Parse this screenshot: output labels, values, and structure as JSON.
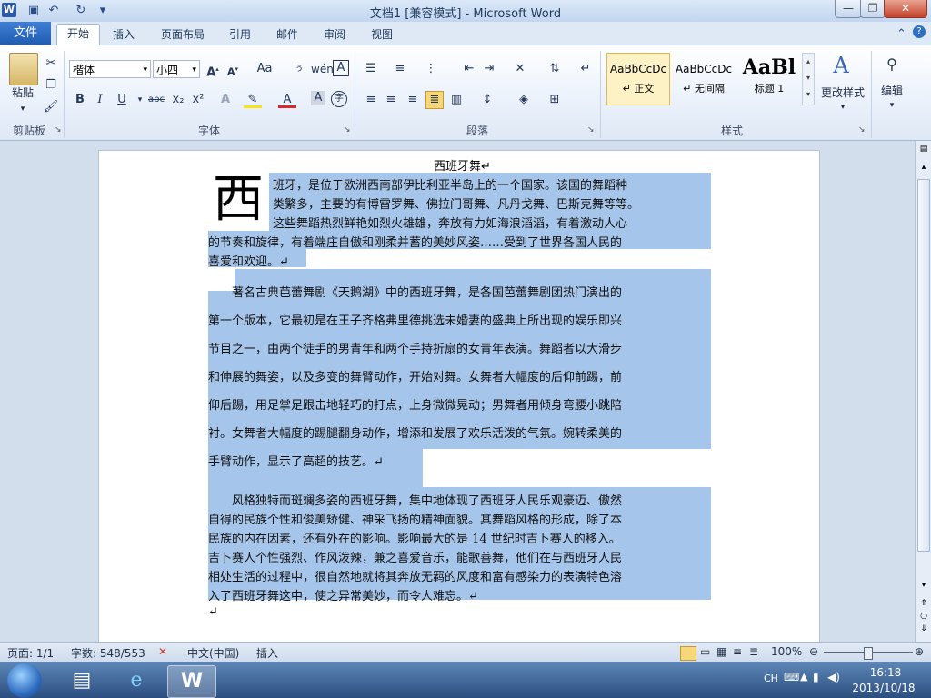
{
  "window": {
    "title": "文档1 [兼容模式]  -  Microsoft Word",
    "app_icon": "W",
    "controls": [
      "—",
      "❐",
      "✕"
    ]
  },
  "quick_access": {
    "save": "💾",
    "undo": "↶",
    "redo": "↻",
    "customize": "▾"
  },
  "tabs": {
    "file": "文件",
    "items": [
      "开始",
      "插入",
      "页面布局",
      "引用",
      "邮件",
      "审阅",
      "视图"
    ],
    "active_index": 0
  },
  "ribbon": {
    "clipboard": {
      "label": "剪贴板",
      "paste": "粘贴"
    },
    "font": {
      "label": "字体",
      "family": "楷体",
      "size": "小四",
      "buttons": [
        "A",
        "A",
        "Aa",
        "wén",
        "變",
        "A"
      ],
      "format_buttons": [
        "B",
        "I",
        "U",
        "abc",
        "x₂",
        "x²"
      ]
    },
    "paragraph": {
      "label": "段落"
    },
    "styles": {
      "label": "样式",
      "cards": [
        {
          "preview": "AaBbCcDc",
          "name": "↵ 正文"
        },
        {
          "preview": "AaBbCcDc",
          "name": "↵ 无间隔"
        },
        {
          "preview": "AaBl",
          "name": "标题 1"
        }
      ],
      "change_styles": "更改样式"
    },
    "editing": {
      "label": "编辑"
    }
  },
  "document": {
    "title": "西班牙舞↵",
    "dropcap": "西",
    "para1_lines": [
      "班牙，是位于欧洲西南部伊比利亚半岛上的一个国家。该国的舞蹈种",
      "类繁多，主要的有博雷罗舞、佛拉门哥舞、凡丹戈舞、巴斯克舞等等。",
      "这些舞蹈热烈鲜艳如烈火雄雄，奔放有力如海浪滔滔，有着激动人心",
      "的节奏和旋律，有着端庄自傲和刚柔并蓄的美妙风姿……受到了世界各国人民的",
      "喜爱和欢迎。↵"
    ],
    "para2_lines": [
      "　　著名古典芭蕾舞剧《天鹅湖》中的西班牙舞，是各国芭蕾舞剧团热门演出的",
      "第一个版本，它最初是在王子齐格弗里德挑选未婚妻的盛典上所出现的娱乐即兴",
      "节目之一，由两个徒手的男青年和两个手持折扇的女青年表演。舞蹈者以大滑步",
      "和伸展的舞姿，以及多变的舞臂动作，开始对舞。女舞者大幅度的后仰前踢，前",
      "仰后踢，用足掌足跟击地轻巧的打点，上身微微晃动；男舞者用倾身弯腰小跳陪",
      "衬。女舞者大幅度的踢腿翻身动作，增添和发展了欢乐活泼的气氛。婉转柔美的",
      "手臂动作，显示了高超的技艺。↵"
    ],
    "para3_lines": [
      "　　风格独特而斑斓多姿的西班牙舞，集中地体现了西班牙人民乐观豪迈、傲然",
      "自得的民族个性和俊美矫健、神采飞扬的精神面貌。其舞蹈风格的形成，除了本",
      "民族的内在因素，还有外在的影响。影响最大的是 14 世纪时吉卜赛人的移入。",
      "吉卜赛人个性强烈、作风泼辣，兼之喜爱音乐，能歌善舞，他们在与西班牙人民",
      "相处生活的过程中，很自然地就将其奔放无羁的风度和富有感染力的表演特色溶",
      "入了西班牙舞这中，使之异常美妙，而令人难忘。↵"
    ],
    "end_mark": "↵"
  },
  "statusbar": {
    "page": "页面: 1/1",
    "words": "字数: 548/553",
    "language": "中文(中国)",
    "mode": "插入",
    "zoom": "100%"
  },
  "taskbar": {
    "lang": "CH",
    "time": "16:18",
    "date": "2013/10/18"
  }
}
